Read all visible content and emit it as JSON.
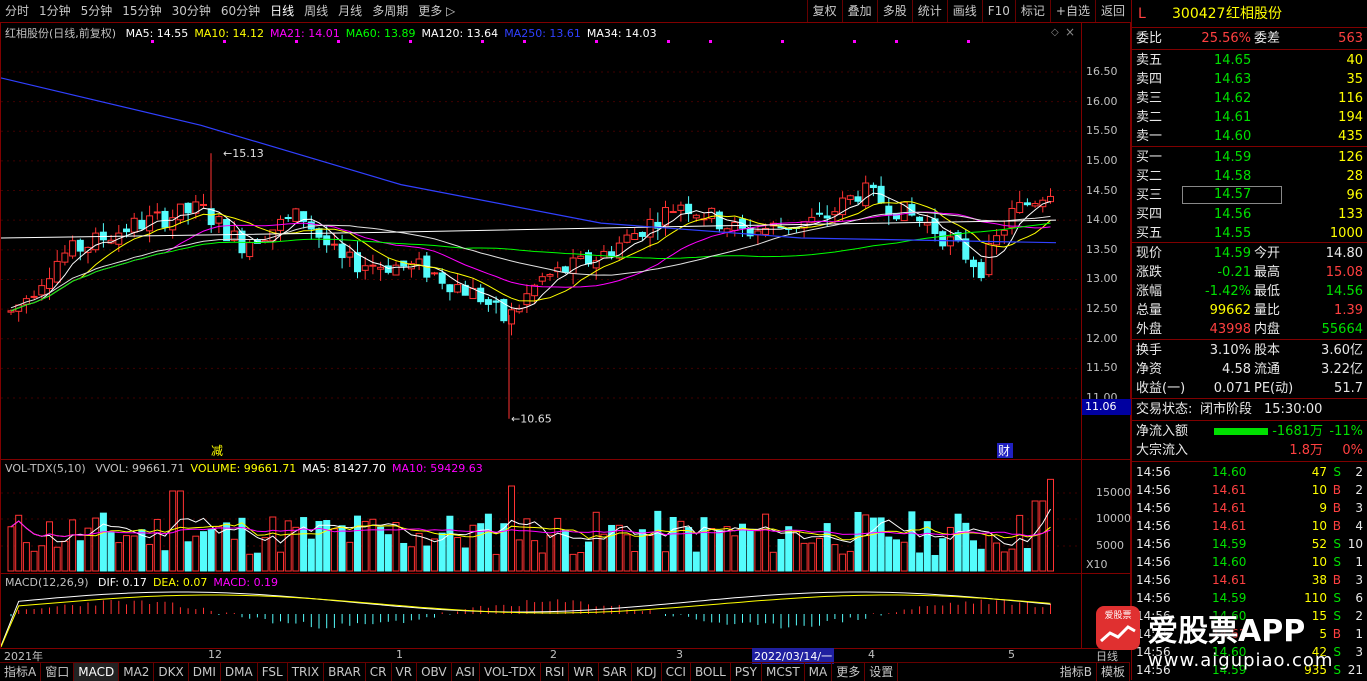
{
  "toolbar": {
    "periods": [
      "分时",
      "1分钟",
      "5分钟",
      "15分钟",
      "30分钟",
      "60分钟",
      "日线",
      "周线",
      "月线",
      "多周期",
      "更多 ▷"
    ],
    "active_period": "日线",
    "tools": [
      "复权",
      "叠加",
      "多股",
      "统计",
      "画线",
      "F10",
      "标记",
      "+自选",
      "返回"
    ]
  },
  "main_chart": {
    "title": "红相股份(日线,前复权)",
    "ma": [
      {
        "label": "MA5: 14.55",
        "color": "#ffffff"
      },
      {
        "label": "MA10: 14.12",
        "color": "#ffff00"
      },
      {
        "label": "MA21: 14.01",
        "color": "#ff00ff"
      },
      {
        "label": "MA60: 13.89",
        "color": "#00ff00"
      },
      {
        "label": "MA120: 13.64",
        "color": "#ffffff"
      },
      {
        "label": "MA250: 13.61",
        "color": "#3040ff"
      },
      {
        "label": "MA34: 14.03",
        "color": "#ffffff"
      }
    ],
    "yticks": [
      "16.50",
      "16.00",
      "15.50",
      "15.00",
      "14.50",
      "14.00",
      "13.50",
      "13.00",
      "12.50",
      "12.00",
      "11.50",
      "11.00"
    ],
    "current_marker": "11.06",
    "high_label": "15.13",
    "low_label": "10.65",
    "marker_jian": "减",
    "marker_cai": "财"
  },
  "volume_chart": {
    "title": "VOL-TDX(5,10)",
    "items": [
      {
        "label": "VVOL: 99661.71",
        "color": "#c0c0c0"
      },
      {
        "label": "VOLUME: 99661.71",
        "color": "#ffff00"
      },
      {
        "label": "MA5: 81427.70",
        "color": "#ffffff"
      },
      {
        "label": "MA10: 59429.63",
        "color": "#ff00ff"
      }
    ],
    "yticks": [
      "15000",
      "10000",
      "5000"
    ],
    "unit": "X10"
  },
  "macd_chart": {
    "title": "MACD(12,26,9)",
    "items": [
      {
        "label": "DIF: 0.17",
        "color": "#ffffff"
      },
      {
        "label": "DEA: 0.07",
        "color": "#ffff00"
      },
      {
        "label": "MACD: 0.19",
        "color": "#ff00ff"
      }
    ]
  },
  "xaxis": {
    "labels": [
      "2021年",
      "12",
      "1",
      "2",
      "3",
      "2022/03/14/一",
      "4",
      "5"
    ],
    "right_label": "日线"
  },
  "bottom_tabs": [
    "指标A",
    "窗口",
    "MACD",
    "MA2",
    "DKX",
    "DMI",
    "DMA",
    "FSL",
    "TRIX",
    "BRAR",
    "CR",
    "VR",
    "OBV",
    "ASI",
    "VOL-TDX",
    "RSI",
    "WR",
    "SAR",
    "KDJ",
    "CCI",
    "BOLL",
    "PSY",
    "MCST",
    "MA",
    "更多",
    "设置"
  ],
  "bottom_right_tabs": [
    "指标B",
    "模板"
  ],
  "active_tab": "MACD",
  "stock": {
    "flag": "L",
    "code": "300427",
    "name": "红相股份"
  },
  "weibi": {
    "label1": "委比",
    "val1": "25.56%",
    "label2": "委差",
    "val2": "563"
  },
  "asks": [
    {
      "label": "卖五",
      "price": "14.65",
      "vol": "40"
    },
    {
      "label": "卖四",
      "price": "14.63",
      "vol": "35"
    },
    {
      "label": "卖三",
      "price": "14.62",
      "vol": "116"
    },
    {
      "label": "卖二",
      "price": "14.61",
      "vol": "194"
    },
    {
      "label": "卖一",
      "price": "14.60",
      "vol": "435"
    }
  ],
  "bids": [
    {
      "label": "买一",
      "price": "14.59",
      "vol": "126"
    },
    {
      "label": "买二",
      "price": "14.58",
      "vol": "28"
    },
    {
      "label": "买三",
      "price": "14.57",
      "vol": "96"
    },
    {
      "label": "买四",
      "price": "14.56",
      "vol": "133"
    },
    {
      "label": "买五",
      "price": "14.55",
      "vol": "1000"
    }
  ],
  "quote": [
    {
      "l1": "现价",
      "v1": "14.59",
      "c1": "green",
      "l2": "今开",
      "v2": "14.80",
      "c2": "white"
    },
    {
      "l1": "涨跌",
      "v1": "-0.21",
      "c1": "green",
      "l2": "最高",
      "v2": "15.08",
      "c2": "red"
    },
    {
      "l1": "涨幅",
      "v1": "-1.42%",
      "c1": "green",
      "l2": "最低",
      "v2": "14.56",
      "c2": "green"
    },
    {
      "l1": "总量",
      "v1": "99662",
      "c1": "yellow",
      "l2": "量比",
      "v2": "1.39",
      "c2": "red"
    },
    {
      "l1": "外盘",
      "v1": "43998",
      "c1": "red",
      "l2": "内盘",
      "v2": "55664",
      "c2": "green"
    }
  ],
  "fund": [
    {
      "l1": "换手",
      "v1": "3.10%",
      "l2": "股本",
      "v2": "3.60亿"
    },
    {
      "l1": "净资",
      "v1": "4.58",
      "l2": "流通",
      "v2": "3.22亿"
    },
    {
      "l1": "收益(一)",
      "v1": "0.071",
      "l2": "PE(动)",
      "v2": "51.7"
    }
  ],
  "status": {
    "label": "交易状态:",
    "state": "闭市阶段",
    "time": "15:30:00"
  },
  "flow": [
    {
      "label": "净流入额",
      "val": "-1681万",
      "pct": "-11%",
      "color": "green"
    },
    {
      "label": "大宗流入",
      "val": "1.8万",
      "pct": "0%",
      "color": "red"
    }
  ],
  "ticks": [
    {
      "time": "14:56",
      "price": "14.60",
      "vol": "47",
      "bs": "S",
      "n": "2"
    },
    {
      "time": "14:56",
      "price": "14.61",
      "vol": "10",
      "bs": "B",
      "n": "2"
    },
    {
      "time": "14:56",
      "price": "14.61",
      "vol": "9",
      "bs": "B",
      "n": "3"
    },
    {
      "time": "14:56",
      "price": "14.61",
      "vol": "10",
      "bs": "B",
      "n": "4"
    },
    {
      "time": "14:56",
      "price": "14.59",
      "vol": "52",
      "bs": "S",
      "n": "10"
    },
    {
      "time": "14:56",
      "price": "14.60",
      "vol": "10",
      "bs": "S",
      "n": "1"
    },
    {
      "time": "14:56",
      "price": "14.61",
      "vol": "38",
      "bs": "B",
      "n": "3"
    },
    {
      "time": "14:56",
      "price": "14.59",
      "vol": "110",
      "bs": "S",
      "n": "6"
    },
    {
      "time": "14:56",
      "price": "14.60",
      "vol": "15",
      "bs": "S",
      "n": "2"
    },
    {
      "time": "14:56",
      "price": "14.61",
      "vol": "5",
      "bs": "B",
      "n": "1"
    },
    {
      "time": "14:56",
      "price": "14.60",
      "vol": "42",
      "bs": "S",
      "n": "3"
    },
    {
      "time": "14:56",
      "price": "14.59",
      "vol": "935",
      "bs": "S",
      "n": "21"
    }
  ],
  "watermark": {
    "text": "爱股票APP",
    "url": "www.aigupiao.com",
    "logo": "爱股票"
  },
  "colors": {
    "up": "#ff3232",
    "down": "#54fcfc",
    "ma250": "#3040ff",
    "border": "#800000"
  }
}
